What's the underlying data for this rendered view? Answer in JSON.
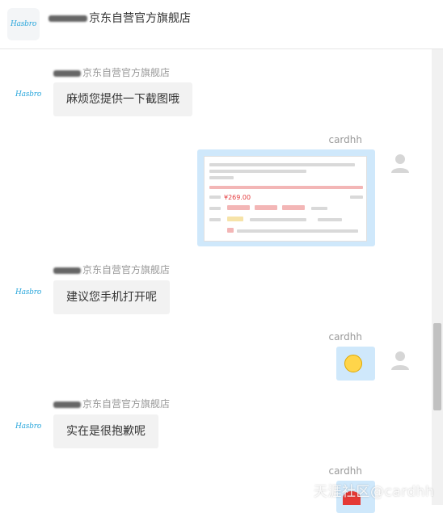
{
  "header": {
    "store_name": "京东自营官方旗舰店",
    "logo_text": "Hasbro"
  },
  "messages": [
    {
      "side": "left",
      "sender": "京东自营官方旗舰店",
      "text": "麻烦您提供一下截图哦"
    },
    {
      "side": "right",
      "sender": "cardhh",
      "type": "image",
      "image_desc": "product-screenshot",
      "price_text": "¥269.00"
    },
    {
      "side": "left",
      "sender": "京东自营官方旗舰店",
      "text": "建议您手机打开呢"
    },
    {
      "side": "right",
      "sender": "cardhh",
      "type": "emoji"
    },
    {
      "side": "left",
      "sender": "京东自营官方旗舰店",
      "text": "实在是很抱歉呢"
    },
    {
      "side": "right",
      "sender": "cardhh",
      "type": "emoji"
    }
  ],
  "watermark": "天涯社区@cardhh",
  "colors": {
    "bubble_right": "#cfe8fb",
    "bubble_left": "#f2f2f2",
    "price": "#e4393c"
  }
}
